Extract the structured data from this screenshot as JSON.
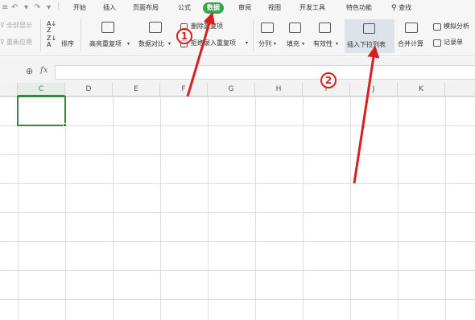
{
  "menu": {
    "items": [
      "开始",
      "插入",
      "页面布局",
      "公式",
      "数据",
      "审阅",
      "视图",
      "开发工具",
      "特色功能"
    ],
    "active": "数据",
    "search_label": "查找"
  },
  "ribbon": {
    "show_all": "全部显示",
    "reapply": "重新应用",
    "sort": "排序",
    "highlight_duplicates": "高亮重复项",
    "data_compare": "数据对比",
    "delete_duplicates": "删除重复项",
    "reject_duplicates": "拒绝录入重复项",
    "split": "分列",
    "fill": "填充",
    "validity": "有效性",
    "insert_dropdown": "插入下拉列表",
    "merge_calc": "合并计算",
    "simulate": "模拟分析",
    "record_sheet": "记录单"
  },
  "formula_bar": {
    "fx": "fx",
    "value": ""
  },
  "columns": [
    "C",
    "D",
    "E",
    "F",
    "G",
    "H",
    "I",
    "J",
    "K"
  ],
  "selected_column": "C",
  "annotations": {
    "step1": "1",
    "step2": "2"
  },
  "colors": {
    "accent_green": "#39a54a",
    "annotation_red": "#d81e1e"
  }
}
